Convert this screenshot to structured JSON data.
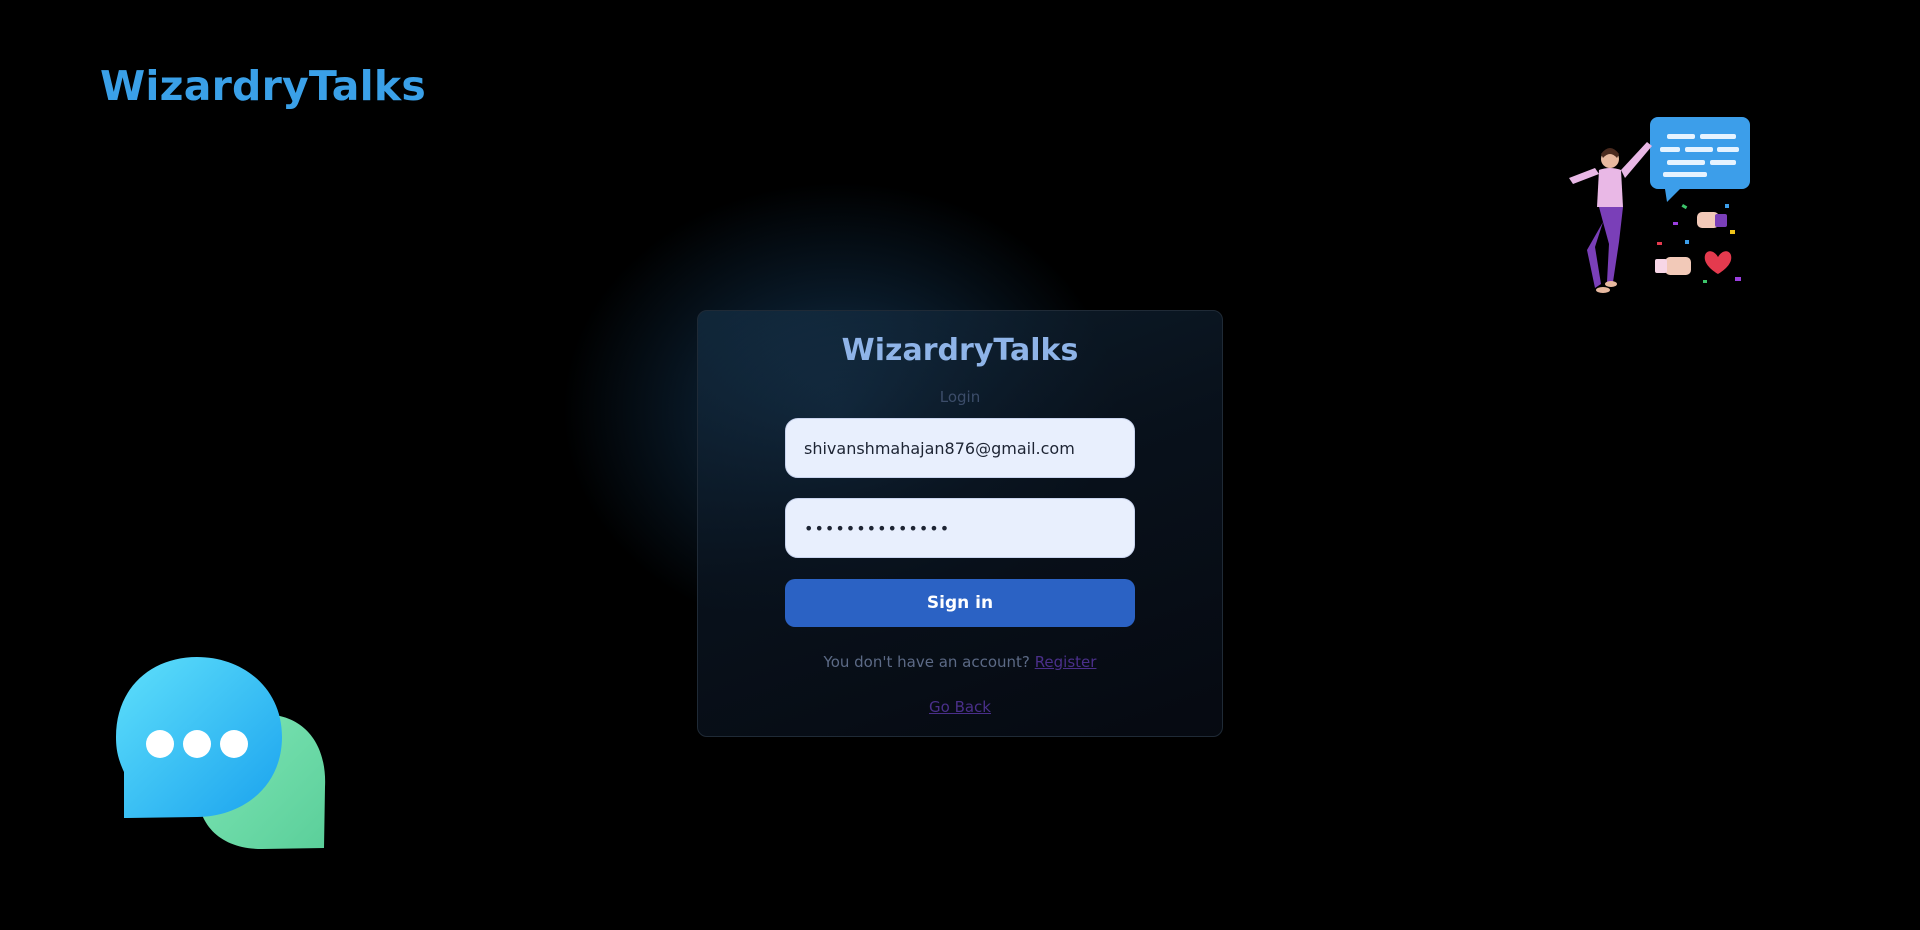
{
  "header": {
    "brand": "WizardryTalks"
  },
  "login_card": {
    "title": "WizardryTalks",
    "subtitle": "Login",
    "email_value": "shivanshmahajan876@gmail.com",
    "password_value": "••••••••••••••",
    "signin_label": "Sign in",
    "account_prompt": "You don't have an account?",
    "register_link": "Register",
    "go_back_link": "Go Back"
  },
  "illustrations": {
    "top_right": "person-with-chat-bubbles-illustration",
    "bottom_left": "chat-bubbles-icon"
  },
  "colors": {
    "background": "#000000",
    "brand": "#3aa0e8",
    "card_title": "#8fb4e8",
    "button": "#2b62c4",
    "link": "#4a2f8a",
    "input_bg": "#e8effd"
  }
}
